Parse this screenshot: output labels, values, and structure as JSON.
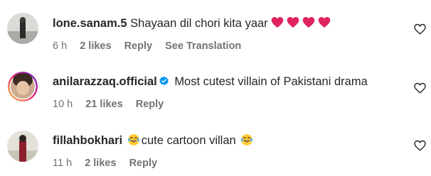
{
  "comments": [
    {
      "username": "lone.sanam.5",
      "text": "Shayaan dil chori kita yaar",
      "emojis": [
        "red-heart",
        "red-heart",
        "red-heart",
        "red-heart"
      ],
      "time": "6 h",
      "likes": "2 likes",
      "reply": "Reply",
      "translation": "See Translation"
    },
    {
      "username": "anilarazzaq.official",
      "verified": true,
      "text": "Most cutest villain of Pakistani drama",
      "time": "10 h",
      "likes": "21 likes",
      "reply": "Reply"
    },
    {
      "username": "fillahbokhari",
      "text_before_emoji": "",
      "text": "cute cartoon villan",
      "emojis": [
        "laughing-tears",
        "laughing-tears"
      ],
      "time": "11 h",
      "likes": "2 likes",
      "reply": "Reply"
    }
  ],
  "colors": {
    "text": "#262626",
    "meta": "#737373",
    "verified": "#0095f6",
    "heart_emoji": "#e0245e"
  }
}
